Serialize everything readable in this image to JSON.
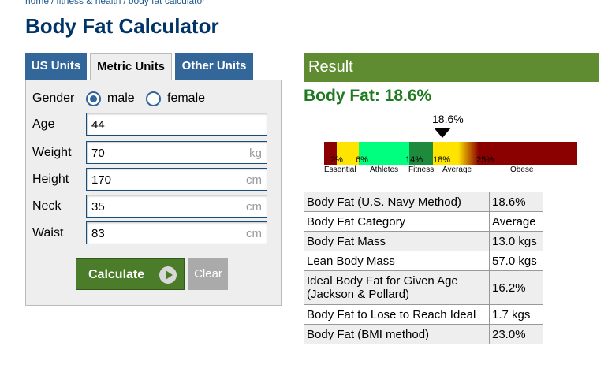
{
  "breadcrumb": [
    "home",
    "fitness & health",
    "body fat calculator"
  ],
  "page_title": "Body Fat Calculator",
  "tabs": [
    {
      "label": "US Units",
      "active": false
    },
    {
      "label": "Metric Units",
      "active": true
    },
    {
      "label": "Other Units",
      "active": false
    }
  ],
  "form": {
    "gender": {
      "label": "Gender",
      "options": [
        "male",
        "female"
      ],
      "selected": "male"
    },
    "age": {
      "label": "Age",
      "value": "44",
      "unit": ""
    },
    "weight": {
      "label": "Weight",
      "value": "70",
      "unit": "kg"
    },
    "height": {
      "label": "Height",
      "value": "170",
      "unit": "cm"
    },
    "neck": {
      "label": "Neck",
      "value": "35",
      "unit": "cm"
    },
    "waist": {
      "label": "Waist",
      "value": "83",
      "unit": "cm"
    },
    "calculate_label": "Calculate",
    "clear_label": "Clear"
  },
  "result": {
    "header": "Result",
    "headline": "Body Fat: 18.6%",
    "marker_label": "18.6%",
    "marker_value": 18.6,
    "scale": {
      "ticks": [
        "2%",
        "6%",
        "14%",
        "18%",
        "25%"
      ],
      "categories": [
        "Essential",
        "Athletes",
        "Fitness",
        "Average",
        "Obese"
      ],
      "colors": {
        "essential": "#8b0000",
        "athletes_low": "#ffe400",
        "athletes": "#00ff7f",
        "fitness": "#1e8b3c",
        "average": "#ffe400",
        "obese": "#8b0000"
      }
    },
    "rows": [
      {
        "label": "Body Fat (U.S. Navy Method)",
        "value": "18.6%"
      },
      {
        "label": "Body Fat Category",
        "value": "Average"
      },
      {
        "label": "Body Fat Mass",
        "value": "13.0 kgs"
      },
      {
        "label": "Lean Body Mass",
        "value": "57.0 kgs"
      },
      {
        "label": "Ideal Body Fat for Given Age (Jackson & Pollard)",
        "value": "16.2%"
      },
      {
        "label": "Body Fat to Lose to Reach Ideal",
        "value": "1.7 kgs"
      },
      {
        "label": "Body Fat (BMI method)",
        "value": "23.0%"
      }
    ]
  }
}
